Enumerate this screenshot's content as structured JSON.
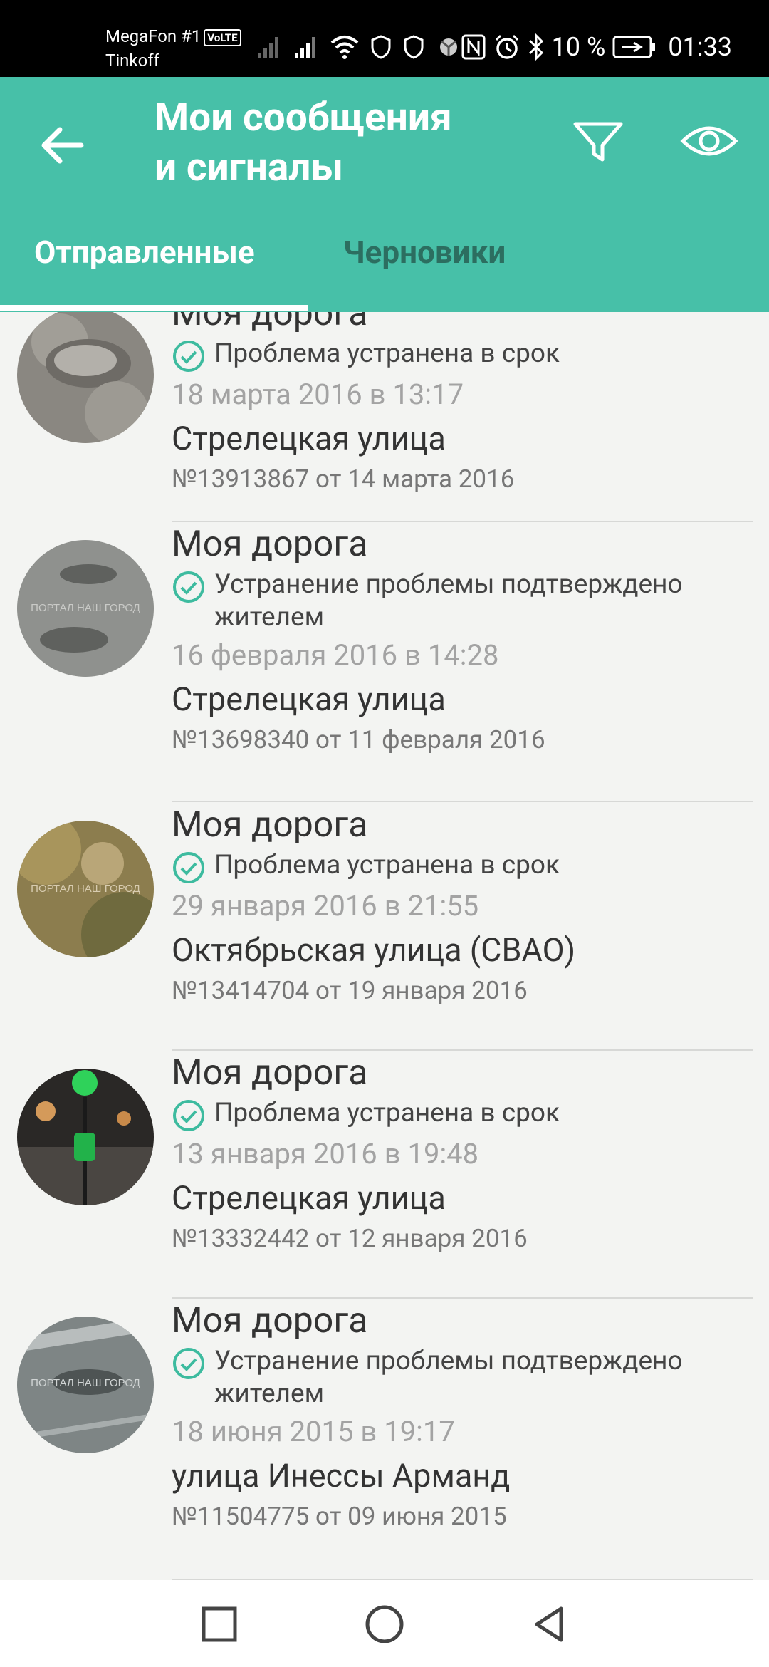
{
  "status_bar": {
    "carrier_line1": "MegaFon #1",
    "volte": "VoLTE",
    "carrier_line2": "Tinkoff",
    "battery": "10 %",
    "time": "01:33"
  },
  "header": {
    "title_line1": "Мои сообщения",
    "title_line2": "и сигналы",
    "back_icon": "arrow-back-icon",
    "filter_icon": "filter-icon",
    "eye_icon": "eye-icon",
    "background": "#47c0a8"
  },
  "tabs": [
    {
      "label": "Отправленные",
      "active": true
    },
    {
      "label": "Черновики",
      "active": false
    }
  ],
  "items": [
    {
      "category": "Моя дорога",
      "status": "Проблема устранена в срок",
      "date": "18 марта 2016 в 13:17",
      "street": "Стрелецкая улица",
      "number": "№13913867 от 14 марта 2016"
    },
    {
      "category": "Моя дорога",
      "status": "Устранение проблемы подтверждено жителем",
      "date": "16 февраля 2016 в 14:28",
      "street": "Стрелецкая улица",
      "number": "№13698340 от 11 февраля 2016"
    },
    {
      "category": "Моя дорога",
      "status": "Проблема устранена в срок",
      "date": "29 января 2016 в 21:55",
      "street": "Октябрьская улица (СВАО)",
      "number": "№13414704 от 19 января 2016"
    },
    {
      "category": "Моя дорога",
      "status": "Проблема устранена в срок",
      "date": "13 января 2016 в 19:48",
      "street": "Стрелецкая улица",
      "number": "№13332442 от 12 января 2016"
    },
    {
      "category": "Моя дорога",
      "status": "Устранение проблемы подтверждено жителем",
      "date": "18 июня 2015 в 19:17",
      "street": "улица Инессы Арманд",
      "number": "№11504775 от 09 июня 2015"
    }
  ],
  "nav": {
    "recents_icon": "square-icon",
    "home_icon": "circle-icon",
    "back_icon": "triangle-back-icon"
  },
  "colors": {
    "accent": "#47c0a8",
    "check": "#3dbb9f",
    "inactive_tab": "#2c6e60"
  }
}
